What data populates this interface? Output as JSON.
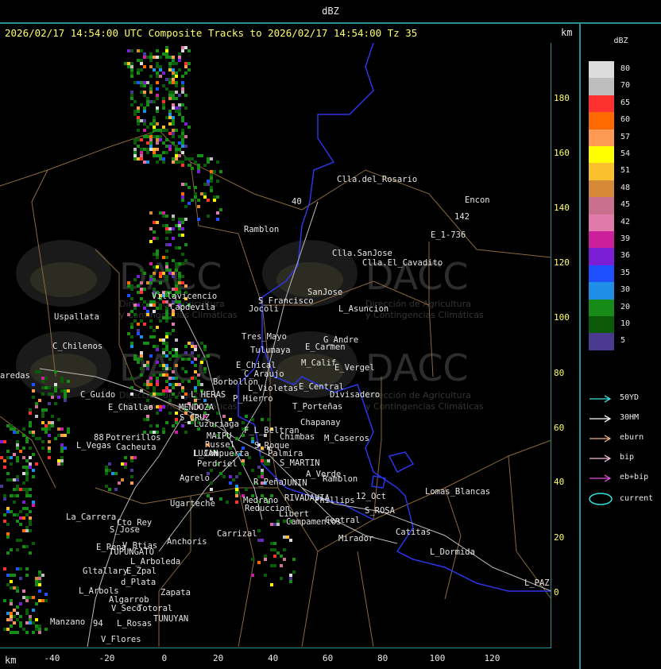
{
  "header": {
    "product": "dBZ",
    "subtitle": "2026/02/17 14:54:00 UTC Composite Tracks to 2026/02/17 14:54:00 Tz 35",
    "km_label": "km"
  },
  "axes": {
    "x_ticks": [
      "-40",
      "-20",
      "0",
      "20",
      "40",
      "60",
      "80",
      "100",
      "120"
    ],
    "y_ticks": [
      "180",
      "160",
      "140",
      "120",
      "100",
      "80",
      "60",
      "40",
      "20",
      "0"
    ],
    "x_km_label": "km"
  },
  "watermark": {
    "name": "DACC",
    "line1": "Dirección de Agricultura",
    "line2": "y Contingencias Climáticas"
  },
  "legend": {
    "title": "dBZ",
    "levels": [
      {
        "label": "80",
        "color": "#dcdcdc"
      },
      {
        "label": "70",
        "color": "#bdbdbd"
      },
      {
        "label": "65",
        "color": "#ff3030"
      },
      {
        "label": "60",
        "color": "#ff6a00"
      },
      {
        "label": "57",
        "color": "#ff9a55"
      },
      {
        "label": "54",
        "color": "#ffff00"
      },
      {
        "label": "51",
        "color": "#fbc02d"
      },
      {
        "label": "48",
        "color": "#d68a38"
      },
      {
        "label": "45",
        "color": "#c9708e"
      },
      {
        "label": "42",
        "color": "#e07aa8"
      },
      {
        "label": "39",
        "color": "#cc1f9c"
      },
      {
        "label": "36",
        "color": "#7b1fd6"
      },
      {
        "label": "35",
        "color": "#1e50ff"
      },
      {
        "label": "30",
        "color": "#1e8ee6"
      },
      {
        "label": "20",
        "color": "#188a18"
      },
      {
        "label": "10",
        "color": "#0a5a0a"
      },
      {
        "label": "5",
        "color": "#4a3a8f"
      }
    ],
    "tracks": [
      {
        "label": "50YD",
        "color": "#40e0e0"
      },
      {
        "label": "30HM",
        "color": "#ffffff"
      },
      {
        "label": "eburn",
        "color": "#e8b080"
      },
      {
        "label": "bip",
        "color": "#f0c0d8"
      },
      {
        "label": "eb+bip",
        "color": "#e050e0"
      }
    ],
    "current": {
      "label": "current",
      "color": "#30e0e0"
    }
  },
  "places": [
    {
      "name": "Clla.del_Rosario"
    },
    {
      "name": "Encon"
    },
    {
      "name": "142"
    },
    {
      "name": "E_1-736"
    },
    {
      "name": "Ramblon"
    },
    {
      "name": "40"
    },
    {
      "name": "Clla.SanJose"
    },
    {
      "name": "Clla.El_Cavadito"
    },
    {
      "name": "Villavicencio"
    },
    {
      "name": "S_Francisco"
    },
    {
      "name": "SanJose"
    },
    {
      "name": "Uspallata"
    },
    {
      "name": "Capdevila"
    },
    {
      "name": "Jocoli"
    },
    {
      "name": "L_Asuncion"
    },
    {
      "name": "Tres_Mayo"
    },
    {
      "name": "G_Andre"
    },
    {
      "name": "C_Chilenos"
    },
    {
      "name": "Tulumaya"
    },
    {
      "name": "E_Carmen"
    },
    {
      "name": "E_Chical"
    },
    {
      "name": "C_Araujo"
    },
    {
      "name": "M_Calif"
    },
    {
      "name": "E_Vergel"
    },
    {
      "name": "aredas"
    },
    {
      "name": "Borbollon"
    },
    {
      "name": "L_Violetas"
    },
    {
      "name": "E_Central"
    },
    {
      "name": "Divisadero"
    },
    {
      "name": "C_Guido"
    },
    {
      "name": "L_HERAS"
    },
    {
      "name": "P_Hierro"
    },
    {
      "name": "E_Challao"
    },
    {
      "name": "MENDOZA"
    },
    {
      "name": "T_Porteñas"
    },
    {
      "name": "S_CRUZ"
    },
    {
      "name": "Luzuriaga"
    },
    {
      "name": "Chapanay"
    },
    {
      "name": "F_L_Beltran"
    },
    {
      "name": "Chimbas"
    },
    {
      "name": "M_Caseros"
    },
    {
      "name": "MAIPU"
    },
    {
      "name": "88"
    },
    {
      "name": "Potrerillos"
    },
    {
      "name": "Russel"
    },
    {
      "name": "L_Vegas"
    },
    {
      "name": "Cacheuta"
    },
    {
      "name": "S_Roque"
    },
    {
      "name": "LUJAN"
    },
    {
      "name": "L_Compuerta"
    },
    {
      "name": "Palmira"
    },
    {
      "name": "Perdriel"
    },
    {
      "name": "S_MARTIN"
    },
    {
      "name": "A_Verde"
    },
    {
      "name": "Agrelo"
    },
    {
      "name": "R_Peña"
    },
    {
      "name": "JUNIN"
    },
    {
      "name": "Ramblon"
    },
    {
      "name": "Ugarteche"
    },
    {
      "name": "Medrano"
    },
    {
      "name": "RIVADAVIA"
    },
    {
      "name": "Phillips"
    },
    {
      "name": "12_Oct"
    },
    {
      "name": "Lomas_Blancas"
    },
    {
      "name": "Reduccion"
    },
    {
      "name": "Libert"
    },
    {
      "name": "S_ROSA"
    },
    {
      "name": "La_Carrera"
    },
    {
      "name": "Cto_Rey"
    },
    {
      "name": "Campamentos"
    },
    {
      "name": "Central"
    },
    {
      "name": "S_Jose"
    },
    {
      "name": "Carrizal"
    },
    {
      "name": "Catitas"
    },
    {
      "name": "Anchoris"
    },
    {
      "name": "V_Btias"
    },
    {
      "name": "E_Pena"
    },
    {
      "name": "TUPUNGATO"
    },
    {
      "name": "Mirador"
    },
    {
      "name": "L_Dormida"
    },
    {
      "name": "L_Arboleda"
    },
    {
      "name": "Gltallary"
    },
    {
      "name": "E_Zpal"
    },
    {
      "name": "d_Plata"
    },
    {
      "name": "L_Arbols"
    },
    {
      "name": "Zapata"
    },
    {
      "name": "L_PAZ"
    },
    {
      "name": "Algarrob"
    },
    {
      "name": "V_Seco"
    },
    {
      "name": "Totoral"
    },
    {
      "name": "TUNUYAN"
    },
    {
      "name": "Manzano"
    },
    {
      "name": "94"
    },
    {
      "name": "L_Rosas"
    },
    {
      "name": "V_Flores"
    }
  ]
}
